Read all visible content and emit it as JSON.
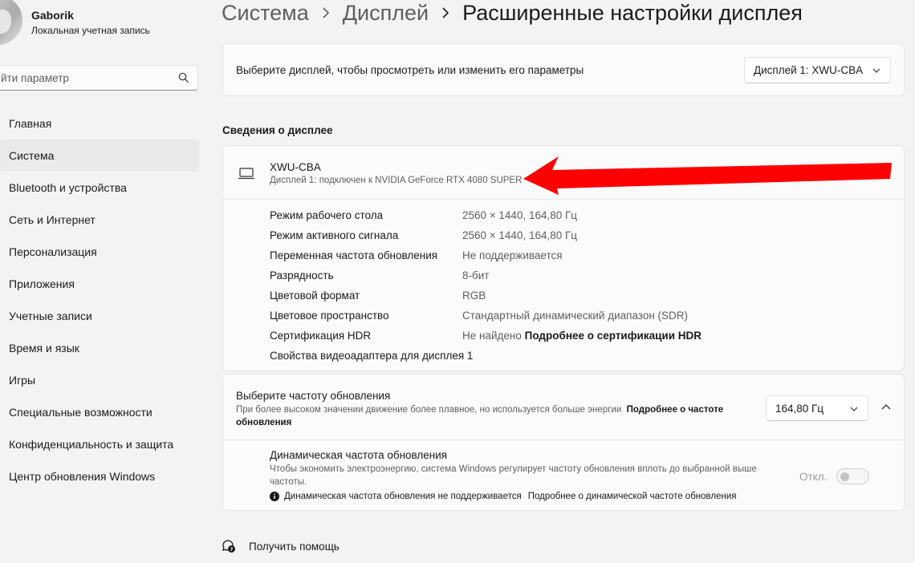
{
  "profile": {
    "name": "Gaborik",
    "account_type": "Локальная учетная запись"
  },
  "search": {
    "placeholder": "йти параметр"
  },
  "sidebar": {
    "items": [
      {
        "label": "Главная"
      },
      {
        "label": "Система",
        "active": true
      },
      {
        "label": "Bluetooth и устройства"
      },
      {
        "label": "Сеть и Интернет"
      },
      {
        "label": "Персонализация"
      },
      {
        "label": "Приложения"
      },
      {
        "label": "Учетные записи"
      },
      {
        "label": "Время и язык"
      },
      {
        "label": "Игры"
      },
      {
        "label": "Специальные возможности"
      },
      {
        "label": "Конфиденциальность и защита"
      },
      {
        "label": "Центр обновления Windows"
      }
    ]
  },
  "breadcrumb": {
    "items": [
      "Система",
      "Дисплей",
      "Расширенные настройки дисплея"
    ]
  },
  "display_select": {
    "label": "Выберите дисплей, чтобы просмотреть или изменить его параметры",
    "value": "Дисплей 1: XWU-CBA"
  },
  "display_info": {
    "section_title": "Сведения о дисплее",
    "name": "XWU-CBA",
    "subtitle": "Дисплей 1: подключен к NVIDIA GeForce RTX 4080 SUPER",
    "properties": [
      {
        "label": "Режим рабочего стола",
        "value": "2560 × 1440, 164,80 Гц"
      },
      {
        "label": "Режим активного сигнала",
        "value": "2560 × 1440, 164,80 Гц"
      },
      {
        "label": "Переменная частота обновления",
        "value": "Не поддерживается"
      },
      {
        "label": "Разрядность",
        "value": "8-бит"
      },
      {
        "label": "Цветовой формат",
        "value": "RGB"
      },
      {
        "label": "Цветовое пространство",
        "value": "Стандартный динамический диапазон (SDR)"
      },
      {
        "label": "Сертификация HDR",
        "value": "Не найдено",
        "link": "Подробнее о сертификации HDR"
      }
    ],
    "adapter_link": "Свойства видеоадаптера для дисплея 1"
  },
  "refresh": {
    "title": "Выберите частоту обновления",
    "desc": "При более высоком значении движение более плавное, но используется больше энергии",
    "desc_link": "Подробнее о частоте обновления",
    "value": "164,80 Гц",
    "dynamic_title": "Динамическая частота обновления",
    "dynamic_desc": "Чтобы экономить электроэнергию, система Windows регулирует частоту обновления вплоть до выбранной выше частоты.",
    "dynamic_note": "Динамическая частота обновления не поддерживается",
    "dynamic_link": "Подробнее о динамической частоте обновления",
    "toggle_label": "Откл."
  },
  "help": {
    "label": "Получить помощь"
  },
  "colors": {
    "accent_arrow": "#ff0000",
    "background": "#f3f3f3",
    "card": "#fbfbfb"
  }
}
